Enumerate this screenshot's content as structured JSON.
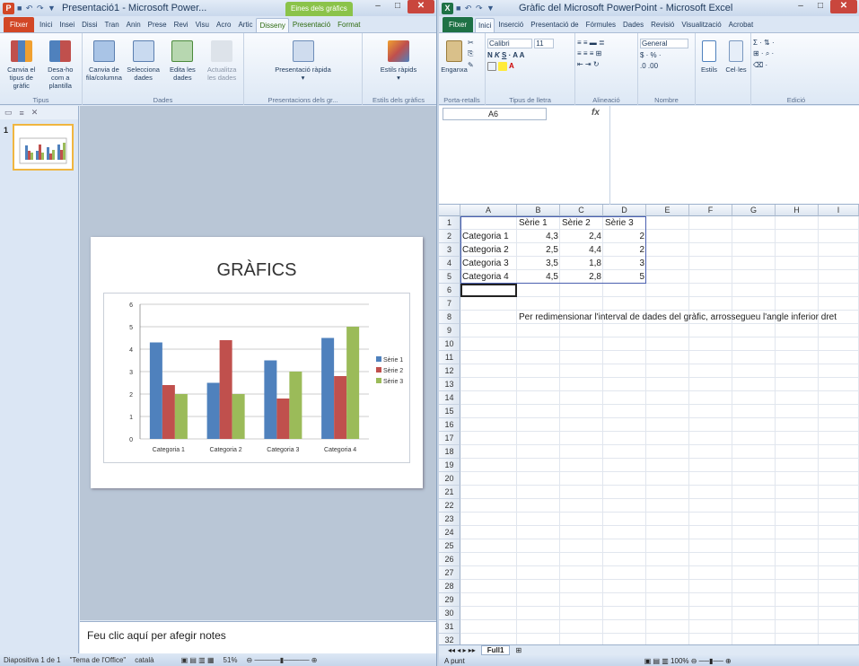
{
  "ppt": {
    "title": "Presentació1 - Microsoft Power...",
    "context_tab": "Eines dels gràfics",
    "tabs": [
      "Fitxer",
      "Inici",
      "Insei",
      "Dissi",
      "Tran",
      "Anin",
      "Prese",
      "Revi",
      "Visu",
      "Acro",
      "Artic",
      "Disseny",
      "Presentació",
      "Format"
    ],
    "ribbon": {
      "b1": "Canvia el tipus de gràfic",
      "b2": "Desa-ho com a plantilla",
      "g1": "Tipus",
      "b3": "Canvia de fila/columna",
      "b4": "Selecciona dades",
      "b5": "Edita les dades",
      "b6": "Actualitza les dades",
      "g2": "Dades",
      "b7": "Presentació ràpida",
      "g3": "Presentacions dels gr...",
      "b8": "Estils ràpids",
      "g4": "Estils dels gràfics"
    },
    "slide_number": "1",
    "slide_title": "GRÀFICS",
    "notes": "Feu clic aquí per afegir notes",
    "status": {
      "slide": "Diapositiva 1 de 1",
      "theme": "\"Tema de l'Office\"",
      "lang": "català",
      "zoom": "51%"
    }
  },
  "excel": {
    "title": "Gràfic del Microsoft PowerPoint - Microsoft Excel",
    "tabs": [
      "Fitxer",
      "Inici",
      "Inserció",
      "Presentació de",
      "Fórmules",
      "Dades",
      "Revisió",
      "Visualització",
      "Acrobat"
    ],
    "ribbon": {
      "paste": "Enganxa",
      "g_clip": "Porta-retalls",
      "font": "Calibri",
      "size": "11",
      "g_font": "Tipus de lletra",
      "g_align": "Alineació",
      "numfmt": "General",
      "g_num": "Nombre",
      "styles": "Estils",
      "cells": "Cel·les",
      "g_edit": "Edició"
    },
    "name_box": "A6",
    "fx": "fx",
    "columns": [
      "A",
      "B",
      "C",
      "D",
      "E",
      "F",
      "G",
      "H",
      "I"
    ],
    "rows": [
      "1",
      "2",
      "3",
      "4",
      "5",
      "6",
      "7",
      "8",
      "9",
      "10",
      "11",
      "12",
      "13",
      "14",
      "15",
      "16",
      "17",
      "18",
      "19",
      "20",
      "21",
      "22",
      "23",
      "24",
      "25",
      "26",
      "27",
      "28",
      "29",
      "30",
      "31",
      "32"
    ],
    "headers": [
      "Sèrie 1",
      "Sèrie 2",
      "Sèrie 3"
    ],
    "table": [
      [
        "Categoria 1",
        "4,3",
        "2,4",
        "2"
      ],
      [
        "Categoria 2",
        "2,5",
        "4,4",
        "2"
      ],
      [
        "Categoria 3",
        "3,5",
        "1,8",
        "3"
      ],
      [
        "Categoria 4",
        "4,5",
        "2,8",
        "5"
      ]
    ],
    "note": "Per redimensionar l'interval de dades del gràfic, arrossegueu l'angle inferior dret",
    "sheet_tab": "Full1",
    "status_left": "A punt",
    "zoom": "100%"
  },
  "chart_data": {
    "type": "bar",
    "categories": [
      "Categoria 1",
      "Categoria 2",
      "Categoria 3",
      "Categoria 4"
    ],
    "series": [
      {
        "name": "Sèrie 1",
        "values": [
          4.3,
          2.5,
          3.5,
          4.5
        ],
        "color": "#4f81bd"
      },
      {
        "name": "Sèrie 2",
        "values": [
          2.4,
          4.4,
          1.8,
          2.8
        ],
        "color": "#c0504d"
      },
      {
        "name": "Sèrie 3",
        "values": [
          2,
          2,
          3,
          5
        ],
        "color": "#9bbb59"
      }
    ],
    "ylim": [
      0,
      6
    ],
    "yticks": [
      "0",
      "1",
      "2",
      "3",
      "4",
      "5",
      "6"
    ],
    "grid": true,
    "legend": "right"
  }
}
